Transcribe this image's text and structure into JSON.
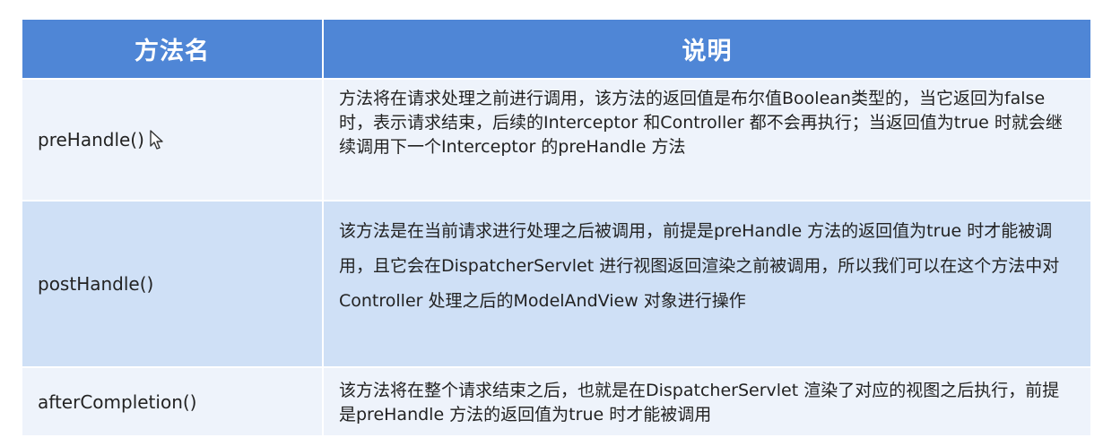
{
  "table": {
    "headers": {
      "method": "方法名",
      "description": "说明"
    },
    "rows": [
      {
        "method": "preHandle()",
        "description": "方法将在请求处理之前进行调用，该方法的返回值是布尔值Boolean类型的，当它返回为false 时，表示请求结束，后续的Interceptor 和Controller 都不会再执行；当返回值为true 时就会继续调用下一个Interceptor 的preHandle 方法"
      },
      {
        "method": "postHandle()",
        "description": "该方法是在当前请求进行处理之后被调用，前提是preHandle 方法的返回值为true 时才能被调用，且它会在DispatcherServlet 进行视图返回渲染之前被调用，所以我们可以在这个方法中对Controller 处理之后的ModelAndView 对象进行操作"
      },
      {
        "method": "afterCompletion()",
        "description": "该方法将在整个请求结束之后，也就是在DispatcherServlet 渲染了对应的视图之后执行，前提是preHandle 方法的返回值为true 时才能被调用"
      }
    ]
  },
  "colors": {
    "header_bg": "#4f86d6",
    "row_light": "#eef3fb",
    "row_mid": "#cfe0f6"
  }
}
